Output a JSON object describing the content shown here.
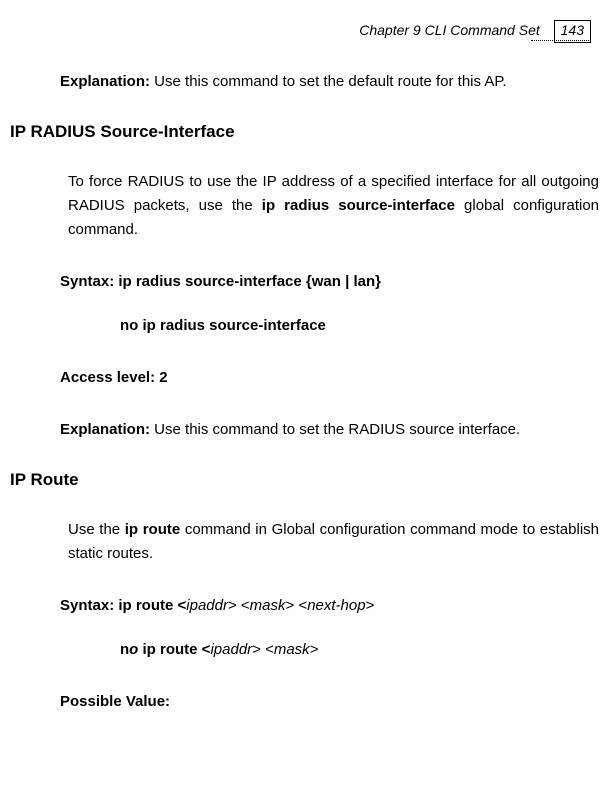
{
  "header": {
    "chapter_label": "Chapter 9 CLI Command Set",
    "page_number": "143"
  },
  "body": {
    "explanation1_label": "Explanation:",
    "explanation1_text": " Use this command to set the default route for this AP.",
    "section1_heading": "IP RADIUS Source-Interface",
    "section1_intro_a": "To force RADIUS to use the IP address of a specified interface for all outgoing RADIUS packets, use the ",
    "section1_intro_b": "ip radius source-interface",
    "section1_intro_c": " global configuration command.",
    "section1_syntax": "Syntax: ip radius source-interface {wan | lan}",
    "section1_syntax_no": "no ip radius source-interface",
    "section1_access": "Access level: 2",
    "section1_expl_label": "Explanation:",
    "section1_expl_text": " Use this command to set the RADIUS source interface.",
    "section2_heading": "IP Route",
    "section2_intro_a": "Use the ",
    "section2_intro_b": "ip route",
    "section2_intro_c": " command in Global configuration command mode to establish static routes.",
    "section2_syntax_a": "Syntax: ip route <",
    "section2_syntax_b": "ipaddr",
    "section2_syntax_c": "> <",
    "section2_syntax_d": "mask",
    "section2_syntax_e": "> <",
    "section2_syntax_f": "next-hop",
    "section2_syntax_g": ">",
    "section2_no_a": "n",
    "section2_no_b": "o ",
    "section2_no_c": " ip route <",
    "section2_no_d": "ipaddr",
    "section2_no_e": "> <",
    "section2_no_f": "mask",
    "section2_no_g": ">",
    "section2_possible": "Possible Value:"
  }
}
